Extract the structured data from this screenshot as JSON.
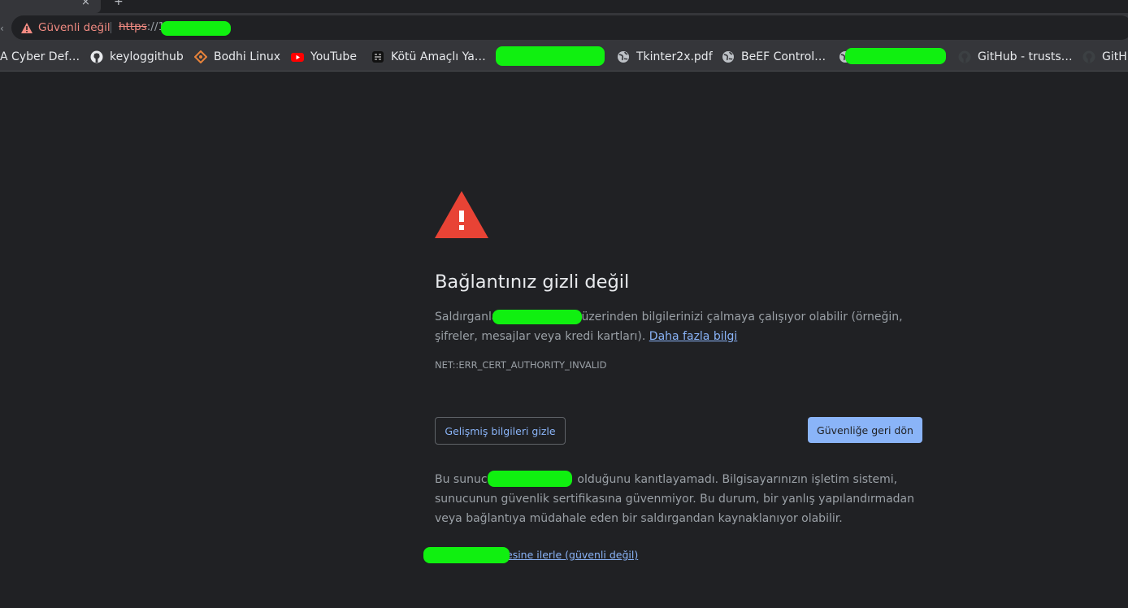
{
  "tabstrip": {
    "close_glyph": "×",
    "newtab_glyph": "+"
  },
  "omnibox": {
    "security_label": "Güvenli değil",
    "url_scheme": "https",
    "url_rest": "://1"
  },
  "bookmarks": [
    {
      "label": "A Cyber Def…",
      "icon": "none"
    },
    {
      "label": "keyloggithub",
      "icon": "github-icon"
    },
    {
      "label": "Bodhi Linux",
      "icon": "bodhi-icon"
    },
    {
      "label": "YouTube",
      "icon": "youtube-icon"
    },
    {
      "label": "Kötü Amaçlı Ya…",
      "icon": "site-icon"
    },
    {
      "label": "Tkinter2x.pdf",
      "icon": "globe-icon"
    },
    {
      "label": "BeEF Control…",
      "icon": "globe-icon"
    },
    {
      "label": "GitHub - trusts…",
      "icon": "github-icon"
    },
    {
      "label": "GitH",
      "icon": "github-icon"
    }
  ],
  "page": {
    "heading": "Bağlantınız gizli değil",
    "para1_start": "Saldırganla",
    "para1_end": "üzerinden bilgilerinizi çalmaya çalışıyor olabilir (örneğin, şifreler, mesajlar veya kredi kartları).",
    "learn_more": "Daha fazla bilgi",
    "error_code": "NET::ERR_CERT_AUTHORITY_INVALID",
    "advanced_button": "Gelişmiş bilgileri gizle",
    "back_button": "Güvenliğe geri dön",
    "para2_start": "Bu sunucu",
    "para2_end": "olduğunu kanıtlayamadı. Bilgisayarınızın işletim sistemi, sunucunun güvenlik sertifikasına güvenmiyor. Bu durum, bir yanlış yapılandırmadan veya bağlantıya müdahale eden bir saldırgandan kaynaklanıyor olabilir.",
    "proceed_link": "esine ilerle (güvenli değil)"
  },
  "colors": {
    "background": "#202124",
    "accent_blue": "#8ab4f8",
    "warning_red": "#e84335",
    "redaction_green": "#10f010"
  }
}
